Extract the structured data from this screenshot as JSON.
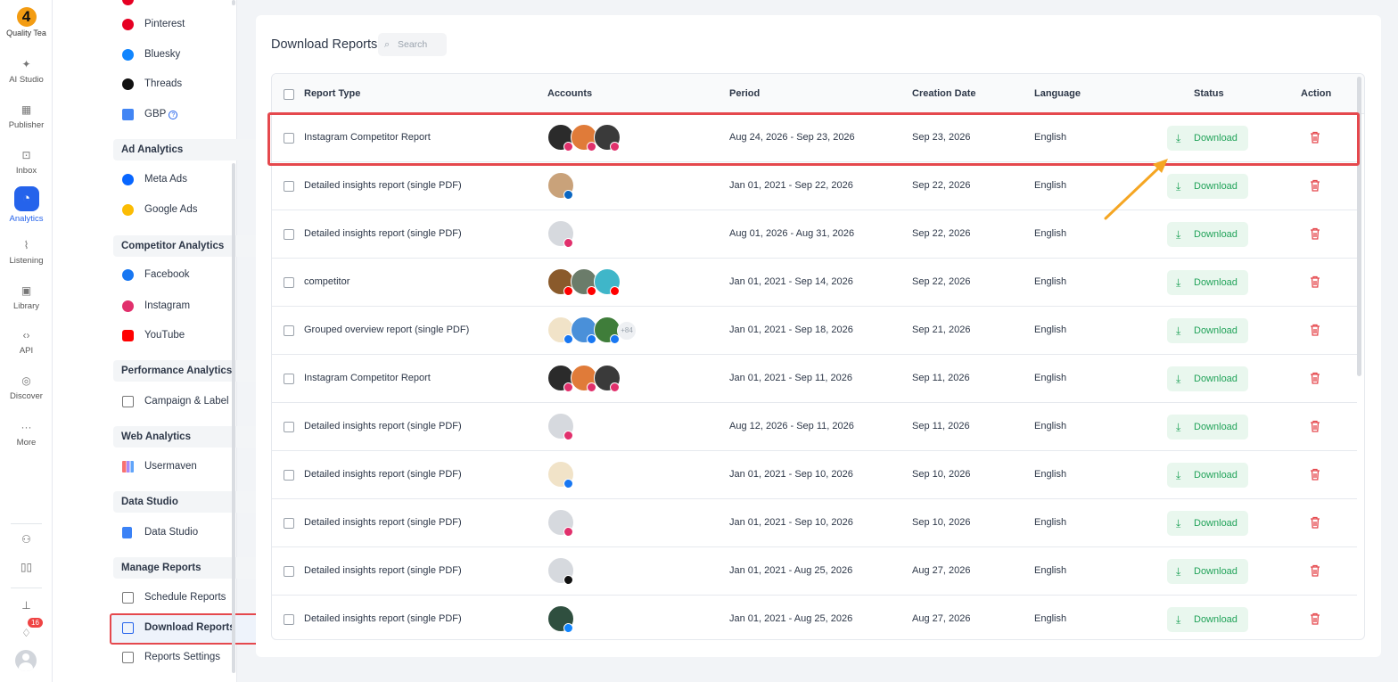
{
  "workspace": {
    "name": "Quality Tea",
    "logo_text": "4"
  },
  "rail": {
    "items": [
      {
        "label": "AI Studio",
        "icon": "sparkle-icon"
      },
      {
        "label": "Publisher",
        "icon": "calendar-icon"
      },
      {
        "label": "Inbox",
        "icon": "inbox-icon"
      },
      {
        "label": "Analytics",
        "icon": "analytics-icon"
      },
      {
        "label": "Listening",
        "icon": "rss-icon"
      },
      {
        "label": "Library",
        "icon": "image-icon"
      },
      {
        "label": "API",
        "icon": "code-icon"
      },
      {
        "label": "Discover",
        "icon": "compass-icon"
      },
      {
        "label": "More",
        "icon": "more-icon"
      }
    ],
    "notification_count": "16"
  },
  "nav": {
    "top_items": [
      "Pinterest",
      "Bluesky",
      "Threads",
      "GBP"
    ],
    "sections": [
      {
        "title": "Ad Analytics",
        "items": [
          "Meta Ads",
          "Google Ads"
        ]
      },
      {
        "title": "Competitor Analytics",
        "items": [
          "Facebook",
          "Instagram",
          "YouTube"
        ]
      },
      {
        "title": "Performance Analytics",
        "items": [
          "Campaign & Label"
        ]
      },
      {
        "title": "Web Analytics",
        "items": [
          "Usermaven"
        ]
      },
      {
        "title": "Data Studio",
        "items": [
          "Data Studio"
        ]
      },
      {
        "title": "Manage Reports",
        "items": [
          "Schedule Reports",
          "Download Reports",
          "Reports Settings"
        ]
      }
    ],
    "selected": "Download Reports"
  },
  "page": {
    "title": "Download Reports",
    "search_placeholder": "Search"
  },
  "table": {
    "headers": [
      "Report Type",
      "Accounts",
      "Period",
      "Creation Date",
      "Language",
      "Status",
      "Action"
    ],
    "rows": [
      {
        "type": "Instagram Competitor Report",
        "period": "Aug 24, 2026 - Sep 23, 2026",
        "created": "Sep 23, 2026",
        "language": "English",
        "status": "Download"
      },
      {
        "type": "Detailed insights report (single PDF)",
        "period": "Jan 01, 2021 - Sep 22, 2026",
        "created": "Sep 22, 2026",
        "language": "English",
        "status": "Download"
      },
      {
        "type": "Detailed insights report (single PDF)",
        "period": "Aug 01, 2026 - Aug 31, 2026",
        "created": "Sep 22, 2026",
        "language": "English",
        "status": "Download"
      },
      {
        "type": "competitor",
        "period": "Jan 01, 2021 - Sep 14, 2026",
        "created": "Sep 22, 2026",
        "language": "English",
        "status": "Download"
      },
      {
        "type": "Grouped overview report (single PDF)",
        "period": "Jan 01, 2021 - Sep 18, 2026",
        "created": "Sep 21, 2026",
        "language": "English",
        "status": "Download",
        "extra_accounts": "+84"
      },
      {
        "type": "Instagram Competitor Report",
        "period": "Jan 01, 2021 - Sep 11, 2026",
        "created": "Sep 11, 2026",
        "language": "English",
        "status": "Download"
      },
      {
        "type": "Detailed insights report (single PDF)",
        "period": "Aug 12, 2026 - Sep 11, 2026",
        "created": "Sep 11, 2026",
        "language": "English",
        "status": "Download"
      },
      {
        "type": "Detailed insights report (single PDF)",
        "period": "Jan 01, 2021 - Sep 10, 2026",
        "created": "Sep 10, 2026",
        "language": "English",
        "status": "Download"
      },
      {
        "type": "Detailed insights report (single PDF)",
        "period": "Jan 01, 2021 - Sep 10, 2026",
        "created": "Sep 10, 2026",
        "language": "English",
        "status": "Download"
      },
      {
        "type": "Detailed insights report (single PDF)",
        "period": "Jan 01, 2021 - Aug 25, 2026",
        "created": "Aug 27, 2026",
        "language": "English",
        "status": "Download"
      },
      {
        "type": "Detailed insights report (single PDF)",
        "period": "Jan 01, 2021 - Aug 25, 2026",
        "created": "Aug 27, 2026",
        "language": "English",
        "status": "Download"
      }
    ]
  },
  "colors": {
    "accent": "#2563eb",
    "highlight": "#e5484d",
    "download_text": "#22a35a",
    "download_bg": "#e9f7ee",
    "arrow": "#f5a623"
  }
}
